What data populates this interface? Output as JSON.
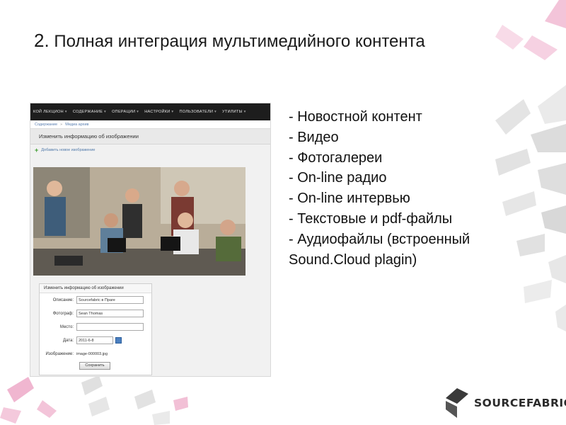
{
  "slide": {
    "title_num": "2.",
    "title_text": "Полная интеграция мультимедийного контента"
  },
  "screenshot": {
    "nav": [
      "КОЙ ЛЕКЦИОН",
      "СОДЕРЖАНИЕ",
      "ОПЕРАЦИИ",
      "НАСТРОЙКИ",
      "ПОЛЬЗОВАТЕЛИ",
      "УТИЛИТЫ"
    ],
    "breadcrumb": [
      "Содержание",
      "Медиа архив"
    ],
    "page_heading": "Изменить информацию об изображении",
    "add_link": "Добавить новое изображение",
    "form": {
      "title": "Изменить информацию об изображении",
      "fields": [
        {
          "label": "Описание:",
          "value": "Sourcefabric в Праге"
        },
        {
          "label": "Фотограф:",
          "value": "Sean Thomas"
        },
        {
          "label": "Место:",
          "value": ""
        },
        {
          "label": "Дата:",
          "value": "2011-6-8"
        }
      ],
      "image_label": "Изображение:",
      "image_file": "image-000003.jpg",
      "save_label": "Сохранить"
    }
  },
  "bullets": [
    "- Новостной контент",
    "- Видео",
    "- Фотогалереи",
    "- On-line радио",
    "- On-line интервью",
    "- Текстовые и pdf-файлы",
    "- Аудиофайлы (встроенный",
    "Sound.Cloud plagin)"
  ],
  "logo": {
    "text": "SOURCEFABRIC"
  },
  "colors": {
    "accent": "#e8a5c8",
    "grey_chevron": "#d5d5d5",
    "text": "#111111"
  }
}
